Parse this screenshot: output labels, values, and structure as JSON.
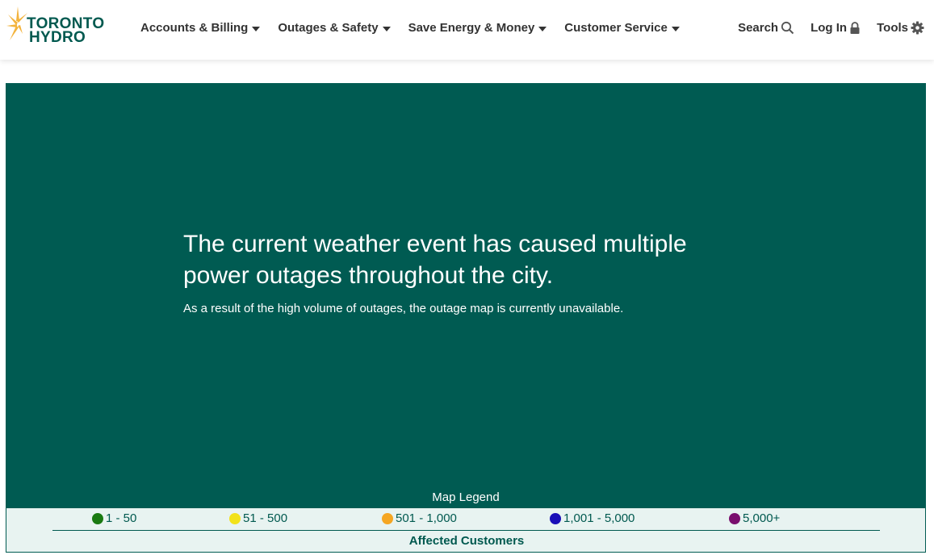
{
  "brand": {
    "logo_line1": "TORONTO",
    "logo_line2": "HYDRO",
    "primary_color": "#00594f",
    "accent_color": "#f3b33d"
  },
  "nav": {
    "items": [
      {
        "label": "Accounts & Billing",
        "icon": "caret-down-icon"
      },
      {
        "label": "Outages & Safety",
        "icon": "caret-down-icon"
      },
      {
        "label": "Save Energy & Money",
        "icon": "caret-down-icon"
      },
      {
        "label": "Customer Service",
        "icon": "caret-down-icon"
      }
    ]
  },
  "utilities": {
    "search_label": "Search",
    "search_icon": "search-icon",
    "login_label": "Log In",
    "login_icon": "lock-icon",
    "tools_label": "Tools",
    "tools_icon": "gear-icon"
  },
  "notice": {
    "title": "The current weather event has caused multiple power outages throughout the city.",
    "message": "As a result of the high volume of outages, the outage map is currently unavailable.",
    "background": "#005b52"
  },
  "legend": {
    "title": "Map Legend",
    "caption": "Affected Customers",
    "items": [
      {
        "label": "1 - 50",
        "color": "#1a7a12"
      },
      {
        "label": "51 - 500",
        "color": "#f2e21a"
      },
      {
        "label": "501 - 1,000",
        "color": "#f5a623"
      },
      {
        "label": "1,001 - 5,000",
        "color": "#1a0fb8"
      },
      {
        "label": "5,000+",
        "color": "#7a0f6e"
      }
    ]
  }
}
